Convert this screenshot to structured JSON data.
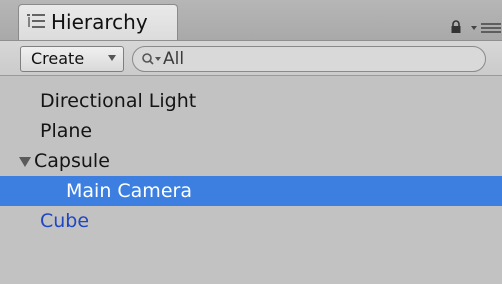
{
  "window": {
    "tab_title": "Hierarchy",
    "tab_icon": "list-icon",
    "lock_icon": "lock-icon",
    "menu_icon": "panel-menu-icon"
  },
  "toolbar": {
    "create_label": "Create",
    "search_placeholder": "All",
    "search_value": ""
  },
  "tree": {
    "items": [
      {
        "label": "Directional Light",
        "depth": 0,
        "selected": false,
        "prefab": false
      },
      {
        "label": "Plane",
        "depth": 0,
        "selected": false,
        "prefab": false
      },
      {
        "label": "Capsule",
        "depth": 0,
        "selected": false,
        "prefab": false,
        "expanded": true
      },
      {
        "label": "Main Camera",
        "depth": 1,
        "selected": true,
        "prefab": false
      },
      {
        "label": "Cube",
        "depth": 0,
        "selected": false,
        "prefab": true
      }
    ]
  },
  "colors": {
    "selection": "#3c7fe0",
    "prefab_text": "#1f47c2",
    "panel_bg": "#c2c2c2"
  }
}
